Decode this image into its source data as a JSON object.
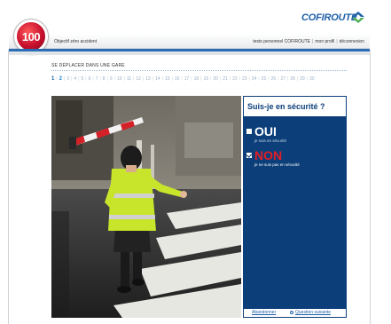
{
  "header": {
    "badge_text": "100",
    "tagline": "Objectif zéro accident",
    "brand": "COFIROUTE",
    "links": [
      "tests personnel COFIROUTE",
      "mon profil",
      "déconnexion"
    ]
  },
  "section": {
    "title": "SE DÉPLACER DANS UNE GARE",
    "pages": [
      "1",
      "2",
      "3",
      "4",
      "5",
      "6",
      "7",
      "8",
      "9",
      "10",
      "11",
      "12",
      "13",
      "14",
      "15",
      "16",
      "17",
      "18",
      "19",
      "20",
      "21",
      "22",
      "23",
      "24",
      "25",
      "26",
      "27",
      "28",
      "29",
      "30"
    ],
    "current_page": "1",
    "active_page": "2"
  },
  "question": {
    "title": "Suis-je en sécurité ?",
    "options": [
      {
        "label": "OUI",
        "sublabel": "je suis en sécurité",
        "checked": false
      },
      {
        "label": "NON",
        "sublabel": "je ne suis pas en sécurité",
        "checked": true
      }
    ],
    "abandon_label": "Abandonner",
    "next_label": "Question suivante"
  },
  "colors": {
    "brand_blue": "#1d5fa8",
    "panel_blue": "#0c3f7a",
    "alert_red": "#e31e24"
  }
}
